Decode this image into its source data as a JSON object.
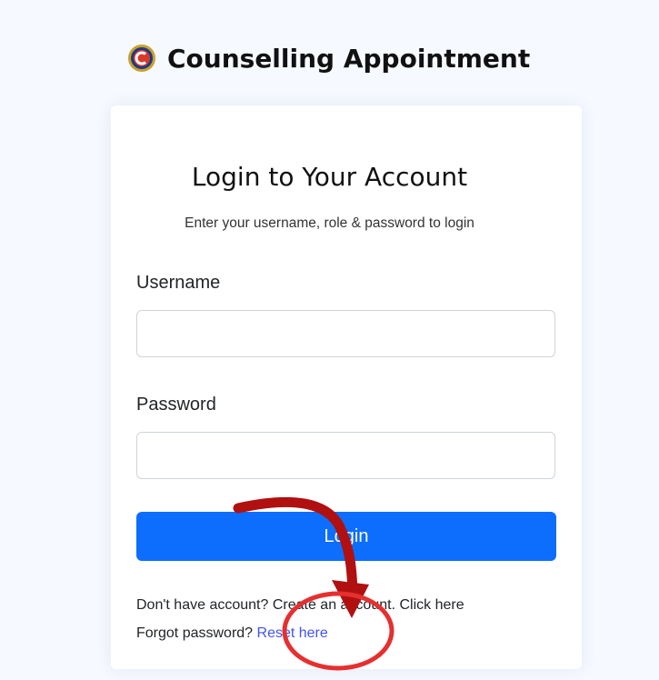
{
  "brand": {
    "title": "Counselling Appointment",
    "logo_icon": "college-emblem-icon"
  },
  "login_card": {
    "title": "Login to Your Account",
    "subtitle": "Enter your username, role & password to login",
    "username_label": "Username",
    "username_value": "",
    "password_label": "Password",
    "password_value": "",
    "login_button": "Login",
    "no_account_text": "Don't have account? Create an account.",
    "click_here_link": "Click here",
    "forgot_text": "Forgot password?",
    "reset_link": "Reset here"
  },
  "annotation": {
    "arrow_color": "#b01010",
    "circle_color": "#e53030",
    "arrow_icon": "curved-arrow-icon",
    "highlight_icon": "highlight-circle-icon"
  },
  "colors": {
    "primary": "#0d6efd",
    "link": "#4154f1",
    "page_bg": "#f6f9ff"
  }
}
